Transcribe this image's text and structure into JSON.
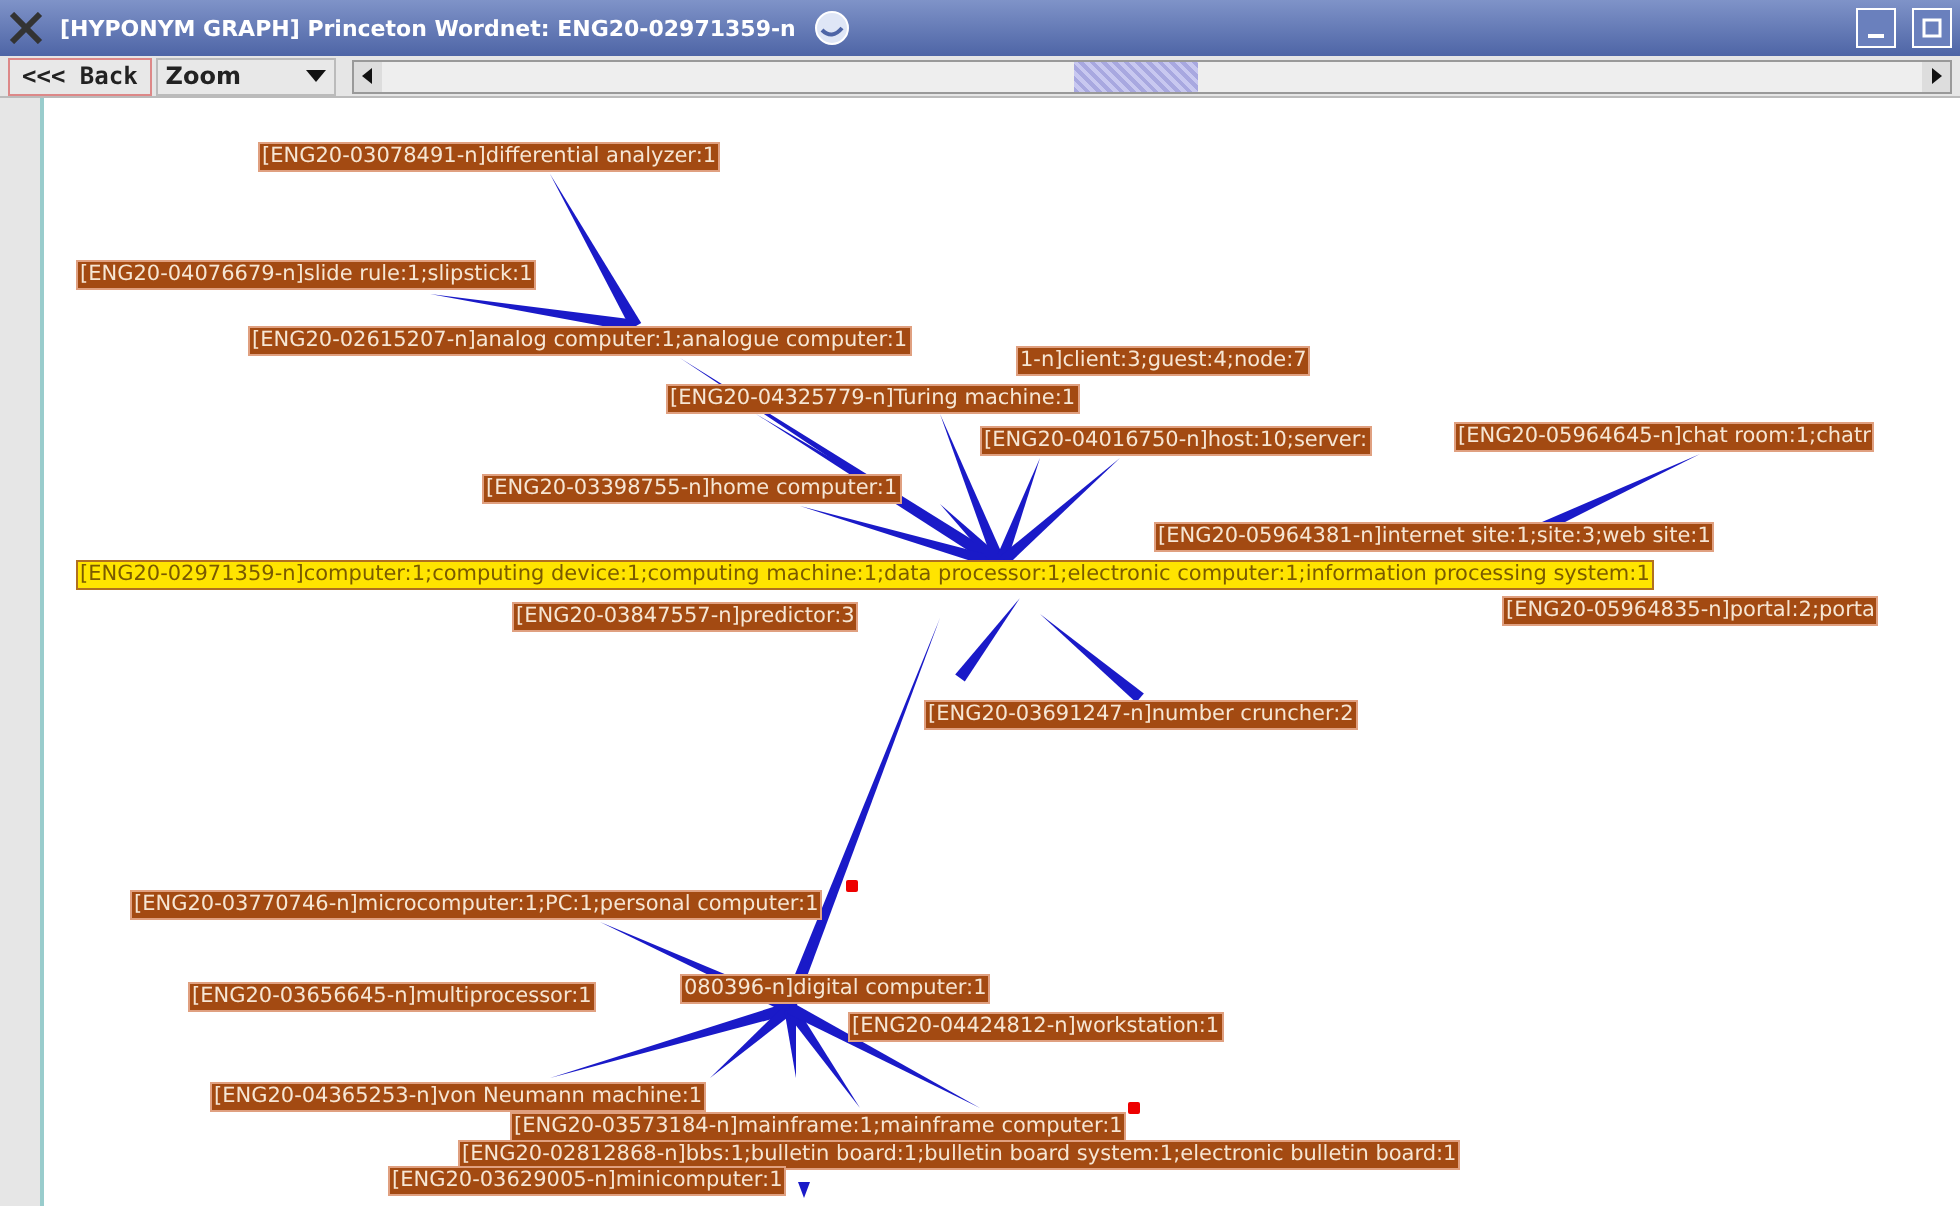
{
  "window": {
    "title": "[HYPONYM GRAPH] Princeton Wordnet: ENG20-02971359-n"
  },
  "toolbar": {
    "back_button": "<<< Back",
    "zoom_dropdown": "Zoom"
  },
  "graph": {
    "nodes": [
      {
        "label": "[ENG20-03078491-n]differential analyzer:1",
        "selected": false,
        "flagged": false
      },
      {
        "label": "[ENG20-04076679-n]slide rule:1;slipstick:1",
        "selected": false,
        "flagged": false
      },
      {
        "label": "[ENG20-02615207-n]analog computer:1;analogue computer:1",
        "selected": false,
        "flagged": false
      },
      {
        "label": "1-n]client:3;guest:4;node:7",
        "selected": false,
        "flagged": false
      },
      {
        "label": "[ENG20-04325779-n]Turing machine:1",
        "selected": false,
        "flagged": false
      },
      {
        "label": "[ENG20-04016750-n]host:10;server:",
        "selected": false,
        "flagged": false
      },
      {
        "label": "[ENG20-05964645-n]chat room:1;chatr",
        "selected": false,
        "flagged": false
      },
      {
        "label": "[ENG20-03398755-n]home computer:1",
        "selected": false,
        "flagged": false
      },
      {
        "label": "[ENG20-05964381-n]internet site:1;site:3;web site:1",
        "selected": false,
        "flagged": false
      },
      {
        "label": "[ENG20-02971359-n]computer:1;computing device:1;computing machine:1;data processor:1;electronic computer:1;information processing system:1",
        "selected": true,
        "flagged": false
      },
      {
        "label": "[ENG20-03847557-n]predictor:3",
        "selected": false,
        "flagged": false
      },
      {
        "label": "[ENG20-05964835-n]portal:2;porta",
        "selected": false,
        "flagged": false
      },
      {
        "label": "[ENG20-03691247-n]number cruncher:2",
        "selected": false,
        "flagged": false
      },
      {
        "label": "[ENG20-03770746-n]microcomputer:1;PC:1;personal computer:1",
        "selected": false,
        "flagged": true
      },
      {
        "label": "[ENG20-03656645-n]multiprocessor:1",
        "selected": false,
        "flagged": false
      },
      {
        "label": "080396-n]digital computer:1",
        "selected": false,
        "flagged": false
      },
      {
        "label": "[ENG20-04424812-n]workstation:1",
        "selected": false,
        "flagged": false
      },
      {
        "label": "[ENG20-04365253-n]von Neumann machine:1",
        "selected": false,
        "flagged": false
      },
      {
        "label": "[ENG20-03573184-n]mainframe:1;mainframe computer:1",
        "selected": false,
        "flagged": true
      },
      {
        "label": "[ENG20-02812868-n]bbs:1;bulletin board:1;bulletin board system:1;electronic bulletin board:1",
        "selected": false,
        "flagged": false
      },
      {
        "label": "[ENG20-03629005-n]minicomputer:1",
        "selected": false,
        "flagged": false
      }
    ]
  }
}
